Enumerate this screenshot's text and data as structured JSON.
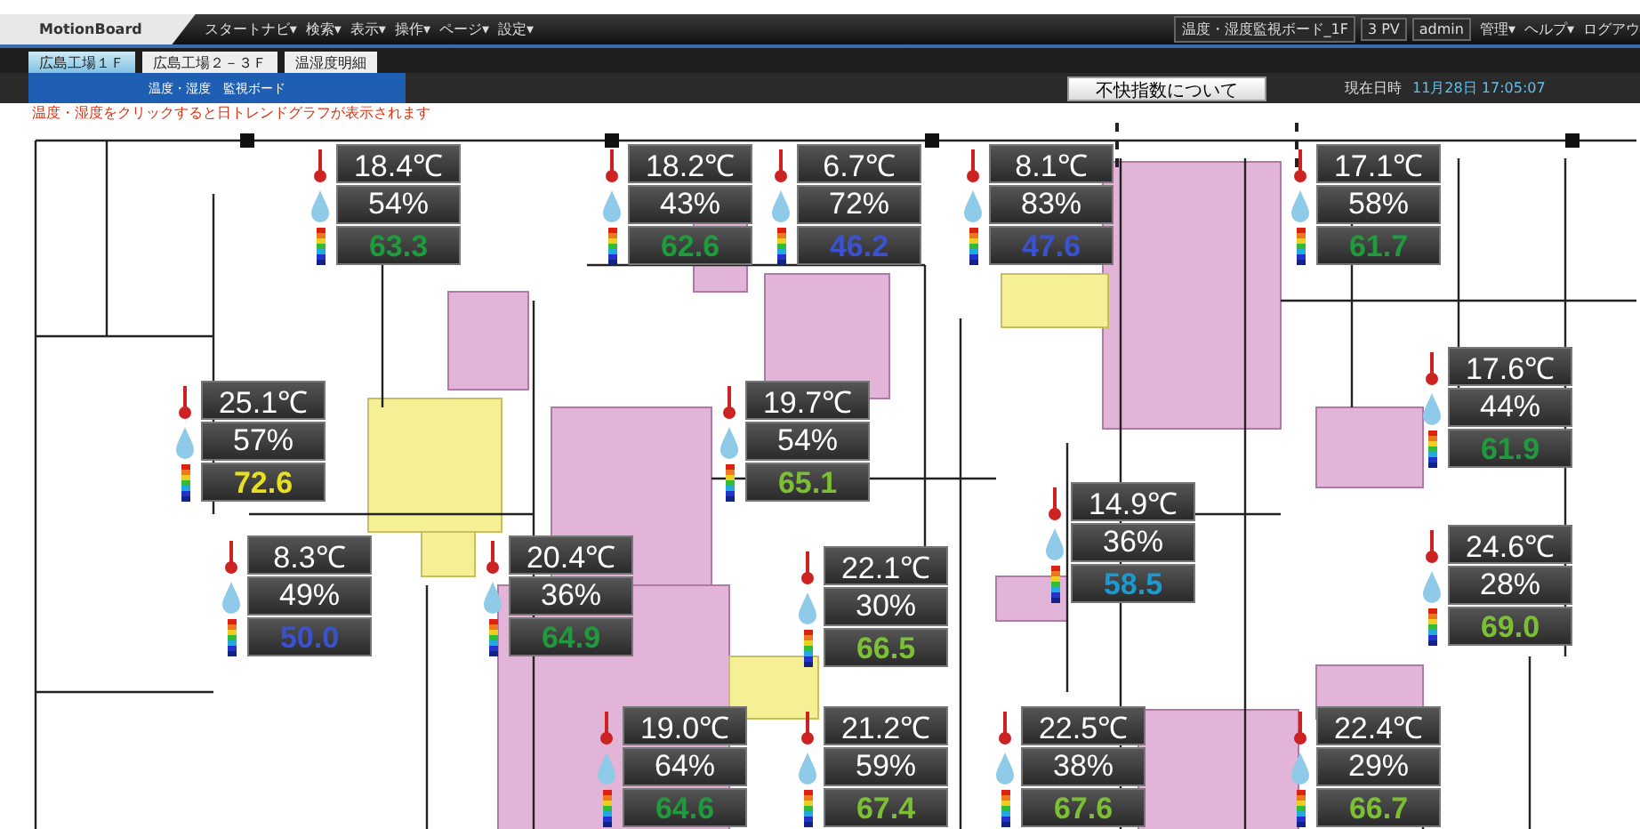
{
  "app": {
    "logo": "MotionBoard",
    "menu": [
      "スタートナビ▾",
      "検索▾",
      "表示▾",
      "操作▾",
      "ページ▾",
      "設定▾"
    ],
    "board_name": "温度・湿度監視ボード_1F",
    "pv": "3 PV",
    "user": "admin",
    "right_menu": [
      "管理▾",
      "ヘルプ▾",
      "ログアウ"
    ]
  },
  "tabs": [
    {
      "label": "広島工場１Ｆ",
      "selected": true
    },
    {
      "label": "広島工場２－３Ｆ",
      "selected": false
    },
    {
      "label": "温湿度明細",
      "selected": false
    }
  ],
  "board": {
    "title": "温度・湿度　監視ボード",
    "info_button": "不快指数について",
    "datetime_label": "現在日時",
    "datetime": "11月28日 17:05:07",
    "hint": "温度・湿度をクリックすると日トレンドグラフが表示されます"
  },
  "sensors": [
    {
      "temperature": "18.4℃",
      "humidity": "54%",
      "index": "63.3",
      "color": "#1f9a3c"
    },
    {
      "temperature": "18.2℃",
      "humidity": "43%",
      "index": "62.6",
      "color": "#1f9a3c"
    },
    {
      "temperature": "6.7℃",
      "humidity": "72%",
      "index": "46.2",
      "color": "#3a52d0"
    },
    {
      "temperature": "8.1℃",
      "humidity": "83%",
      "index": "47.6",
      "color": "#3a52d0"
    },
    {
      "temperature": "17.1℃",
      "humidity": "58%",
      "index": "61.7",
      "color": "#1f9a3c"
    },
    {
      "temperature": "25.1℃",
      "humidity": "57%",
      "index": "72.6",
      "color": "#e6e020"
    },
    {
      "temperature": "19.7℃",
      "humidity": "54%",
      "index": "65.1",
      "color": "#7cbf34"
    },
    {
      "temperature": "17.6℃",
      "humidity": "44%",
      "index": "61.9",
      "color": "#1f9a3c"
    },
    {
      "temperature": "14.9℃",
      "humidity": "36%",
      "index": "58.5",
      "color": "#1c9ad0"
    },
    {
      "temperature": "8.3℃",
      "humidity": "49%",
      "index": "50.0",
      "color": "#3a52d0"
    },
    {
      "temperature": "20.4℃",
      "humidity": "36%",
      "index": "64.9",
      "color": "#1f9a3c"
    },
    {
      "temperature": "22.1℃",
      "humidity": "30%",
      "index": "66.5",
      "color": "#7cbf34"
    },
    {
      "temperature": "24.6℃",
      "humidity": "28%",
      "index": "69.0",
      "color": "#7cbf34"
    },
    {
      "temperature": "19.0℃",
      "humidity": "64%",
      "index": "64.6",
      "color": "#1f9a3c"
    },
    {
      "temperature": "21.2℃",
      "humidity": "59%",
      "index": "67.4",
      "color": "#7cbf34"
    },
    {
      "temperature": "22.5℃",
      "humidity": "38%",
      "index": "67.6",
      "color": "#7cbf34"
    },
    {
      "temperature": "22.4℃",
      "humidity": "29%",
      "index": "66.7",
      "color": "#7cbf34"
    }
  ]
}
